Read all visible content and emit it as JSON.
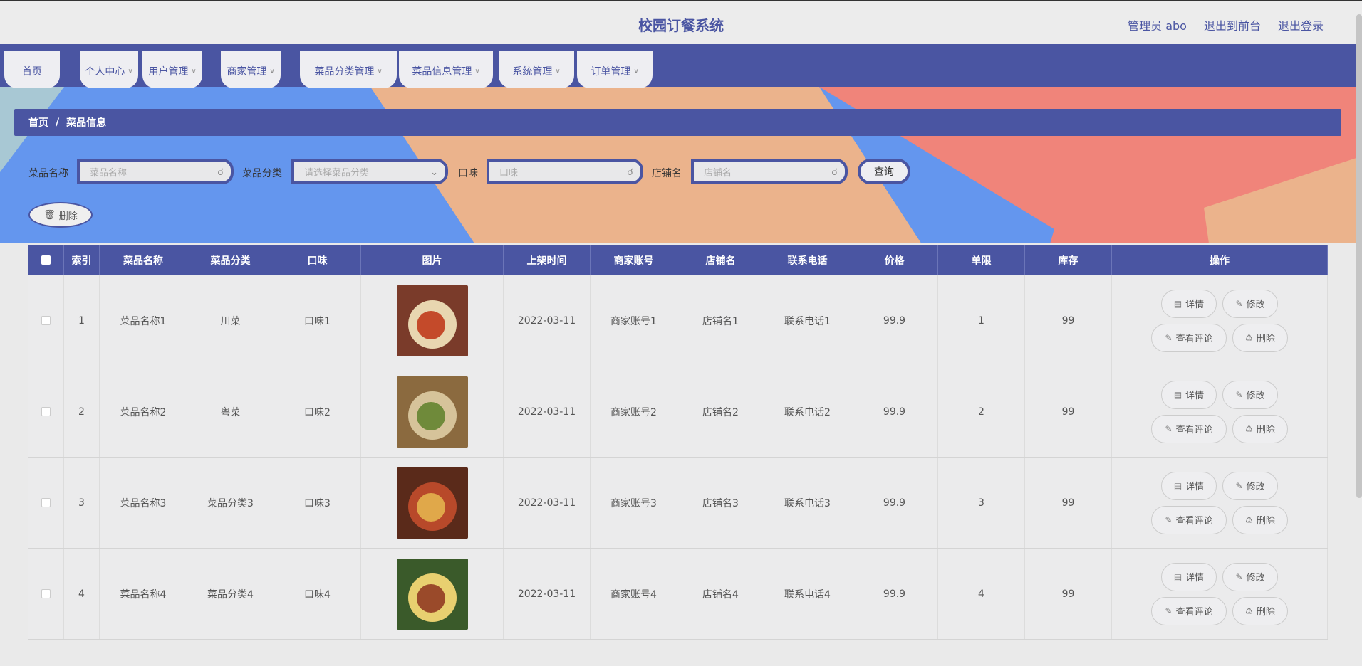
{
  "header": {
    "title": "校园订餐系统",
    "admin": "管理员 abo",
    "to_front": "退出到前台",
    "logout": "退出登录"
  },
  "nav": [
    {
      "label": "首页",
      "chevron": false
    },
    {
      "label": "个人中心",
      "chevron": true
    },
    {
      "label": "用户管理",
      "chevron": true
    },
    {
      "label": "商家管理",
      "chevron": true
    },
    {
      "label": "菜品分类管理",
      "chevron": true
    },
    {
      "label": "菜品信息管理",
      "chevron": true
    },
    {
      "label": "系统管理",
      "chevron": true
    },
    {
      "label": "订单管理",
      "chevron": true
    }
  ],
  "breadcrumb": {
    "home": "首页",
    "sep": "/",
    "current": "菜品信息"
  },
  "search": {
    "name_label": "菜品名称",
    "name_placeholder": "菜品名称",
    "category_label": "菜品分类",
    "category_placeholder": "请选择菜品分类",
    "flavor_label": "口味",
    "flavor_placeholder": "口味",
    "shop_label": "店铺名",
    "shop_placeholder": "店铺名",
    "query_button": "查询"
  },
  "bulk_delete": "删除",
  "table": {
    "columns": [
      "索引",
      "菜品名称",
      "菜品分类",
      "口味",
      "图片",
      "上架时间",
      "商家账号",
      "店铺名",
      "联系电话",
      "价格",
      "单限",
      "库存",
      "操作"
    ],
    "actions": {
      "detail": "详情",
      "edit": "修改",
      "comments": "查看评论",
      "delete": "删除"
    },
    "rows": [
      {
        "index": "1",
        "name": "菜品名称1",
        "category": "川菜",
        "flavor": "口味1",
        "date": "2022-03-11",
        "account": "商家账号1",
        "shop": "店铺名1",
        "phone": "联系电话1",
        "price": "99.9",
        "limit": "1",
        "stock": "99"
      },
      {
        "index": "2",
        "name": "菜品名称2",
        "category": "粤菜",
        "flavor": "口味2",
        "date": "2022-03-11",
        "account": "商家账号2",
        "shop": "店铺名2",
        "phone": "联系电话2",
        "price": "99.9",
        "limit": "2",
        "stock": "99"
      },
      {
        "index": "3",
        "name": "菜品名称3",
        "category": "菜品分类3",
        "flavor": "口味3",
        "date": "2022-03-11",
        "account": "商家账号3",
        "shop": "店铺名3",
        "phone": "联系电话3",
        "price": "99.9",
        "limit": "3",
        "stock": "99"
      },
      {
        "index": "4",
        "name": "菜品名称4",
        "category": "菜品分类4",
        "flavor": "口味4",
        "date": "2022-03-11",
        "account": "商家账号4",
        "shop": "店铺名4",
        "phone": "联系电话4",
        "price": "99.9",
        "limit": "4",
        "stock": "99"
      }
    ]
  },
  "colors": {
    "primary": "#4a55a2",
    "bg_blue": "#6496ee",
    "bg_peach": "#ebb38c",
    "bg_coral": "#f0847a"
  }
}
